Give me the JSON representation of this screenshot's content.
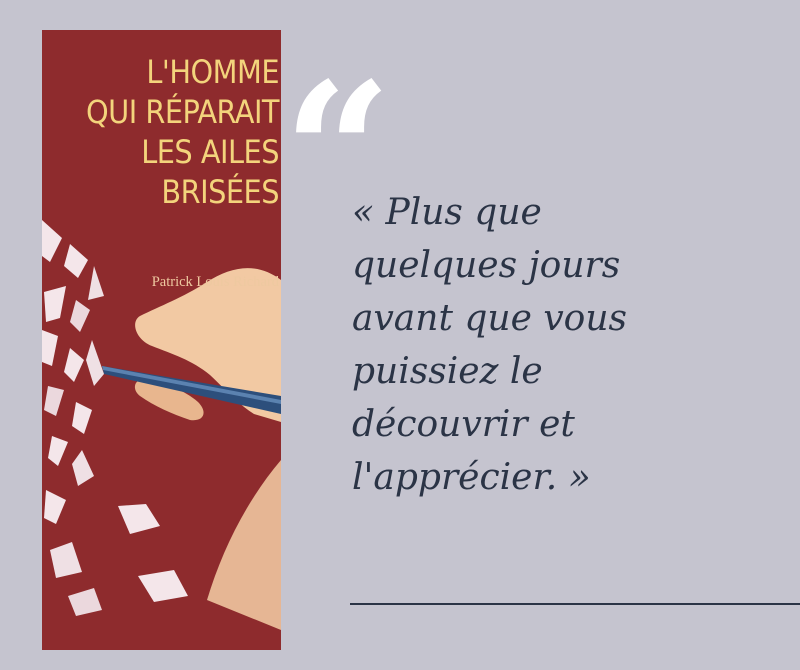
{
  "book": {
    "title_lines": [
      "L'HOMME",
      "QUI RÉPARAIT",
      "LES AILES",
      "BRISÉES"
    ],
    "author": "Patrick Louis Richard"
  },
  "quote_mark": "“",
  "quote_lines": [
    "« Plus que",
    "quelques jours",
    "avant que vous",
    "puissiez le",
    "découvrir et",
    "l'apprécier. »"
  ],
  "colors": {
    "background": "#c5c4cf",
    "cover": "#8e2b2d",
    "cover_title": "#f3d47c",
    "quote_text": "#2b3446",
    "quote_mark": "#ffffff"
  }
}
